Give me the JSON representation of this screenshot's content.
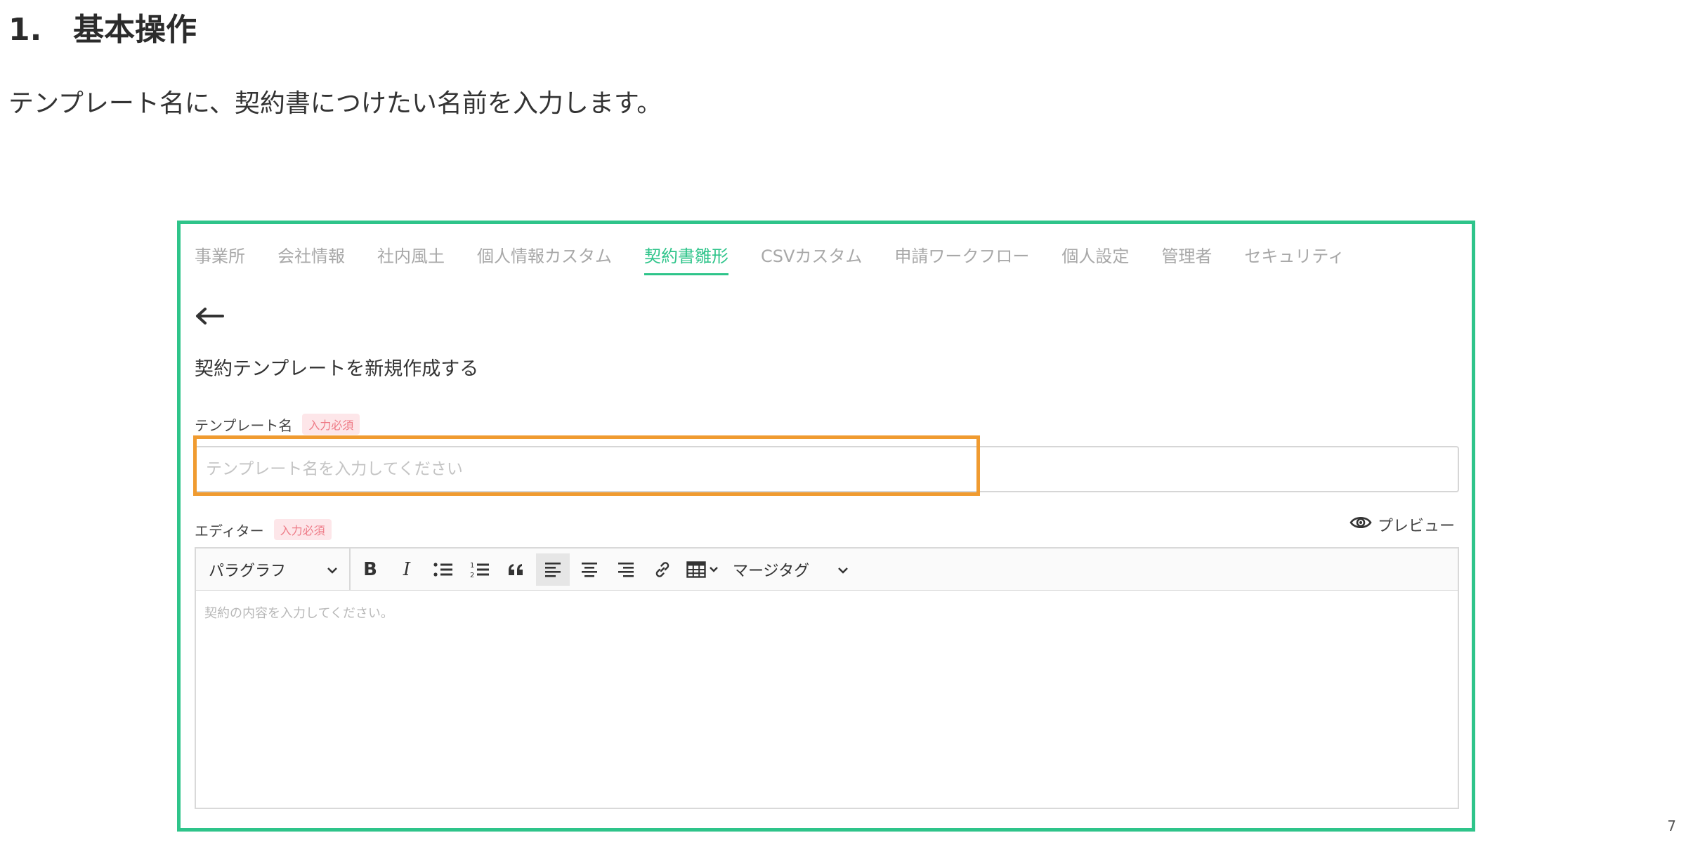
{
  "heading": {
    "number": "1.",
    "title": "基本操作"
  },
  "description": "テンプレート名に、契約書につけたい名前を入力します。",
  "page_number": "7",
  "tabs": [
    {
      "label": "事業所",
      "active": false
    },
    {
      "label": "会社情報",
      "active": false
    },
    {
      "label": "社内風土",
      "active": false
    },
    {
      "label": "個人情報カスタム",
      "active": false
    },
    {
      "label": "契約書雛形",
      "active": true
    },
    {
      "label": "CSVカスタム",
      "active": false
    },
    {
      "label": "申請ワークフロー",
      "active": false
    },
    {
      "label": "個人設定",
      "active": false
    },
    {
      "label": "管理者",
      "active": false
    },
    {
      "label": "セキュリティ",
      "active": false
    }
  ],
  "form": {
    "title": "契約テンプレートを新規作成する",
    "template_name_label": "テンプレート名",
    "required_badge": "入力必須",
    "template_name_placeholder": "テンプレート名を入力してください",
    "template_name_value": "",
    "editor_label": "エディター",
    "preview_label": "プレビュー",
    "editor_placeholder": "契約の内容を入力してください。"
  },
  "toolbar": {
    "paragraph_select": "パラグラフ",
    "bold": "B",
    "italic": "I",
    "merge_tag": "マージタグ"
  },
  "colors": {
    "accent": "#2ec48a",
    "highlight": "#f09b30",
    "required_text": "#ee7a86",
    "required_bg": "#fde6e9"
  }
}
